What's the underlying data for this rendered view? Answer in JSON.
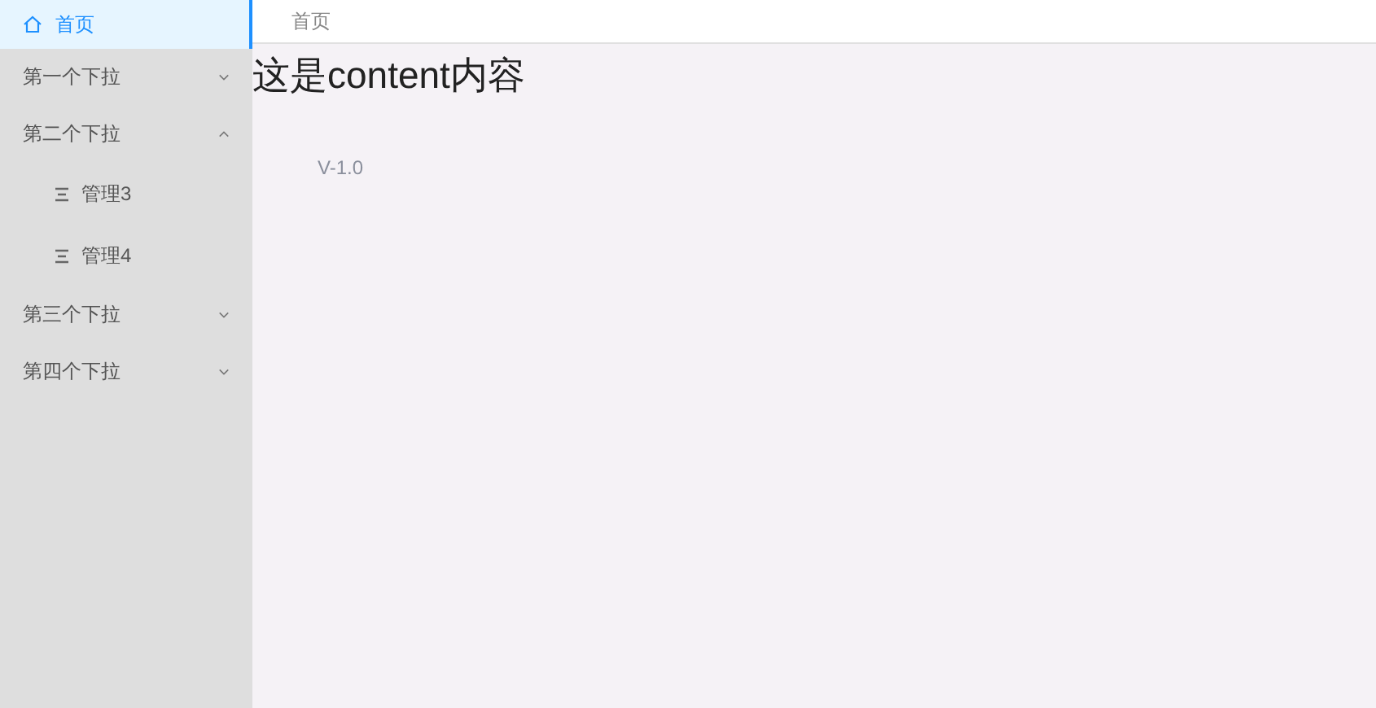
{
  "sidebar": {
    "items": [
      {
        "kind": "link",
        "label": "首页",
        "selected": true
      },
      {
        "kind": "submenu",
        "label": "第一个下拉",
        "expanded": false
      },
      {
        "kind": "submenu",
        "label": "第二个下拉",
        "expanded": true,
        "children": [
          {
            "label": "管理3",
            "selected": false
          },
          {
            "label": "管理4",
            "selected": false
          }
        ]
      },
      {
        "kind": "submenu",
        "label": "第三个下拉",
        "expanded": false
      },
      {
        "kind": "submenu",
        "label": "第四个下拉",
        "expanded": false
      }
    ]
  },
  "breadcrumb": "首页",
  "content": {
    "heading": "这是content内容",
    "version": "V-1.0"
  }
}
